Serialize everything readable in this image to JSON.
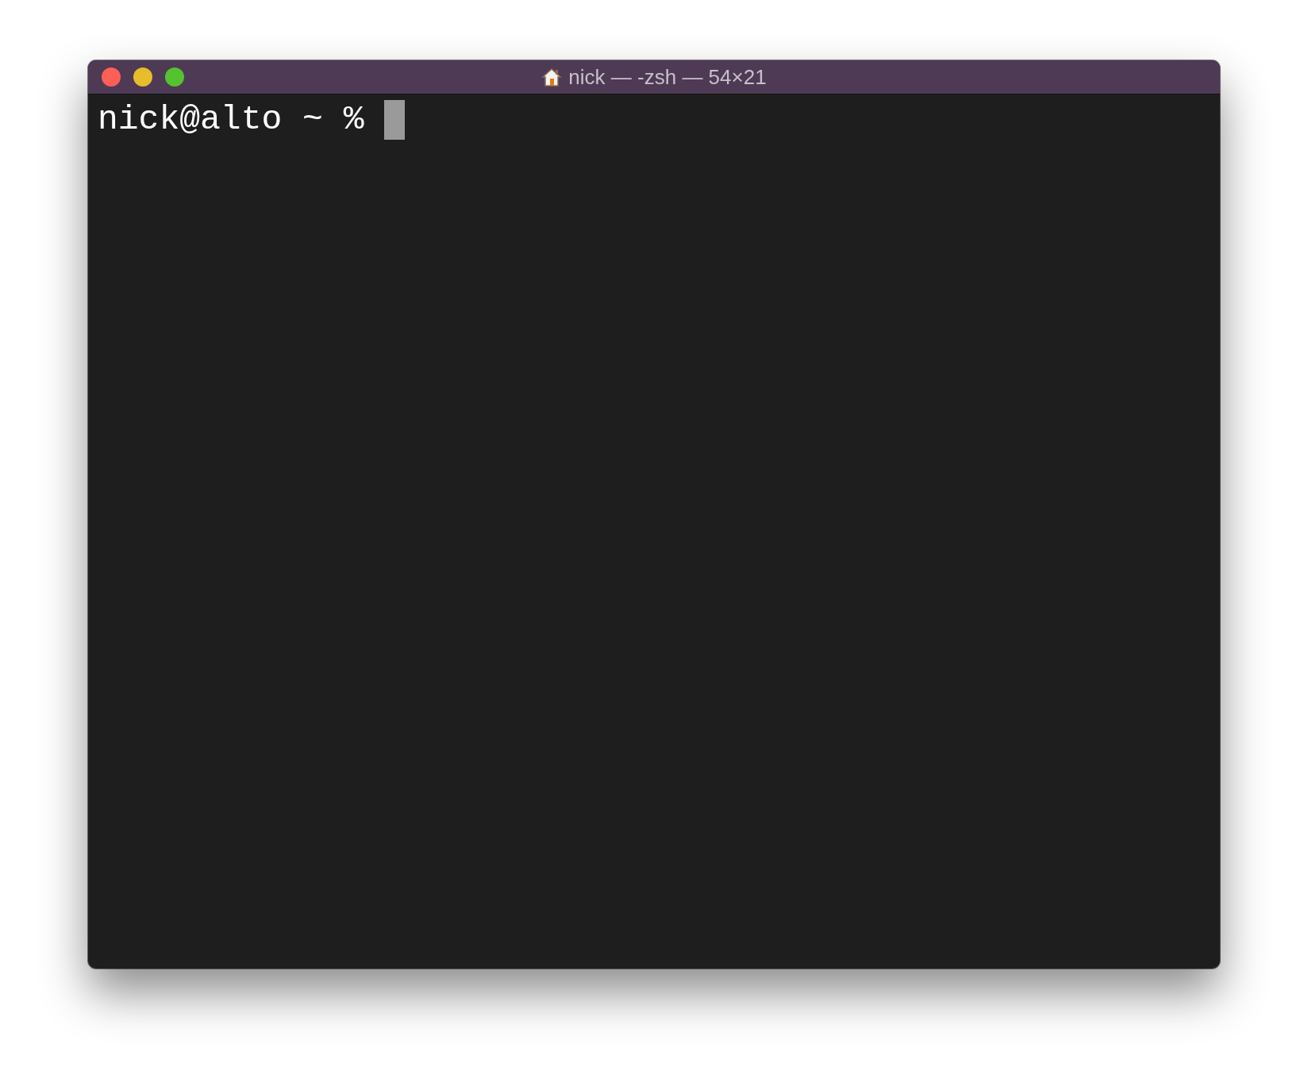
{
  "window": {
    "title": "nick — -zsh — 54×21"
  },
  "terminal": {
    "lines": [
      {
        "prompt": "nick@alto ~ %",
        "cursor": true
      }
    ]
  }
}
